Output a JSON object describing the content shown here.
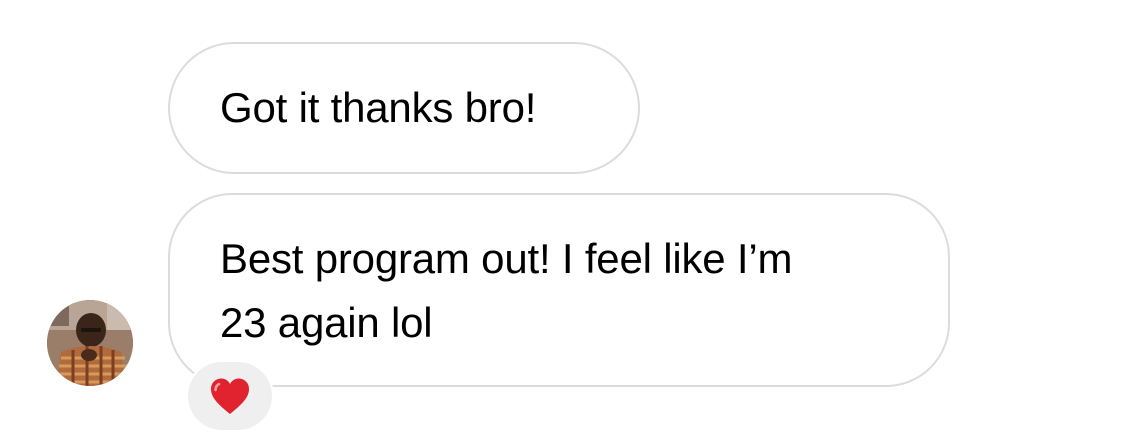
{
  "messages": [
    {
      "text": "Got it thanks bro!"
    },
    {
      "lines": [
        "Best program out! I feel like I’m",
        "23 again lol"
      ]
    }
  ],
  "sender_avatar": {
    "icon": "avatar-photo"
  },
  "reaction": {
    "icon": "red-heart-icon",
    "color": "#e0232e"
  },
  "colors": {
    "bubble_border": "#dcdcdc",
    "reaction_background": "#efefef",
    "text": "#000000"
  }
}
